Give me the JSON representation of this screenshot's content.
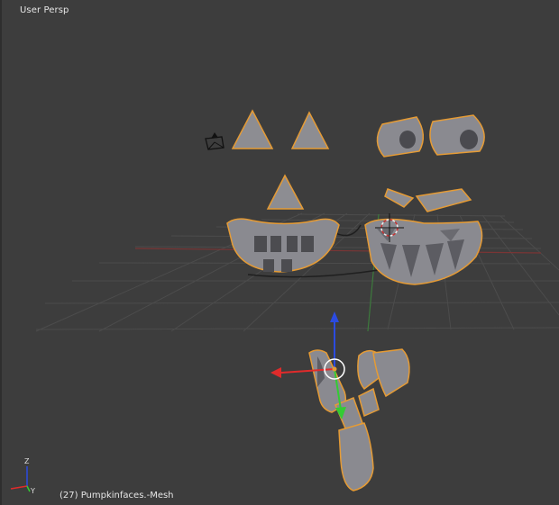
{
  "viewport": {
    "view_label": "User Persp",
    "object_info": "(27) Pumpkinfaces.-Mesh"
  },
  "colors": {
    "background": "#3d3d3d",
    "grid": "#4b4b4b",
    "x_axis": "#8a3b3b",
    "y_axis": "#3f7a3f",
    "mesh_fill": "#8b8b90",
    "mesh_dark": "#5d5d63",
    "selection_outline": "#e59b35",
    "gizmo_x": "#e02b2b",
    "gizmo_y": "#33cc33",
    "gizmo_z": "#2b4be0",
    "cursor_red": "#c83232"
  },
  "icons": {
    "camera": "camera-icon",
    "lamp": "lamp-icon",
    "axis_triad": "axis-triad-icon",
    "cursor": "3d-cursor-icon"
  }
}
